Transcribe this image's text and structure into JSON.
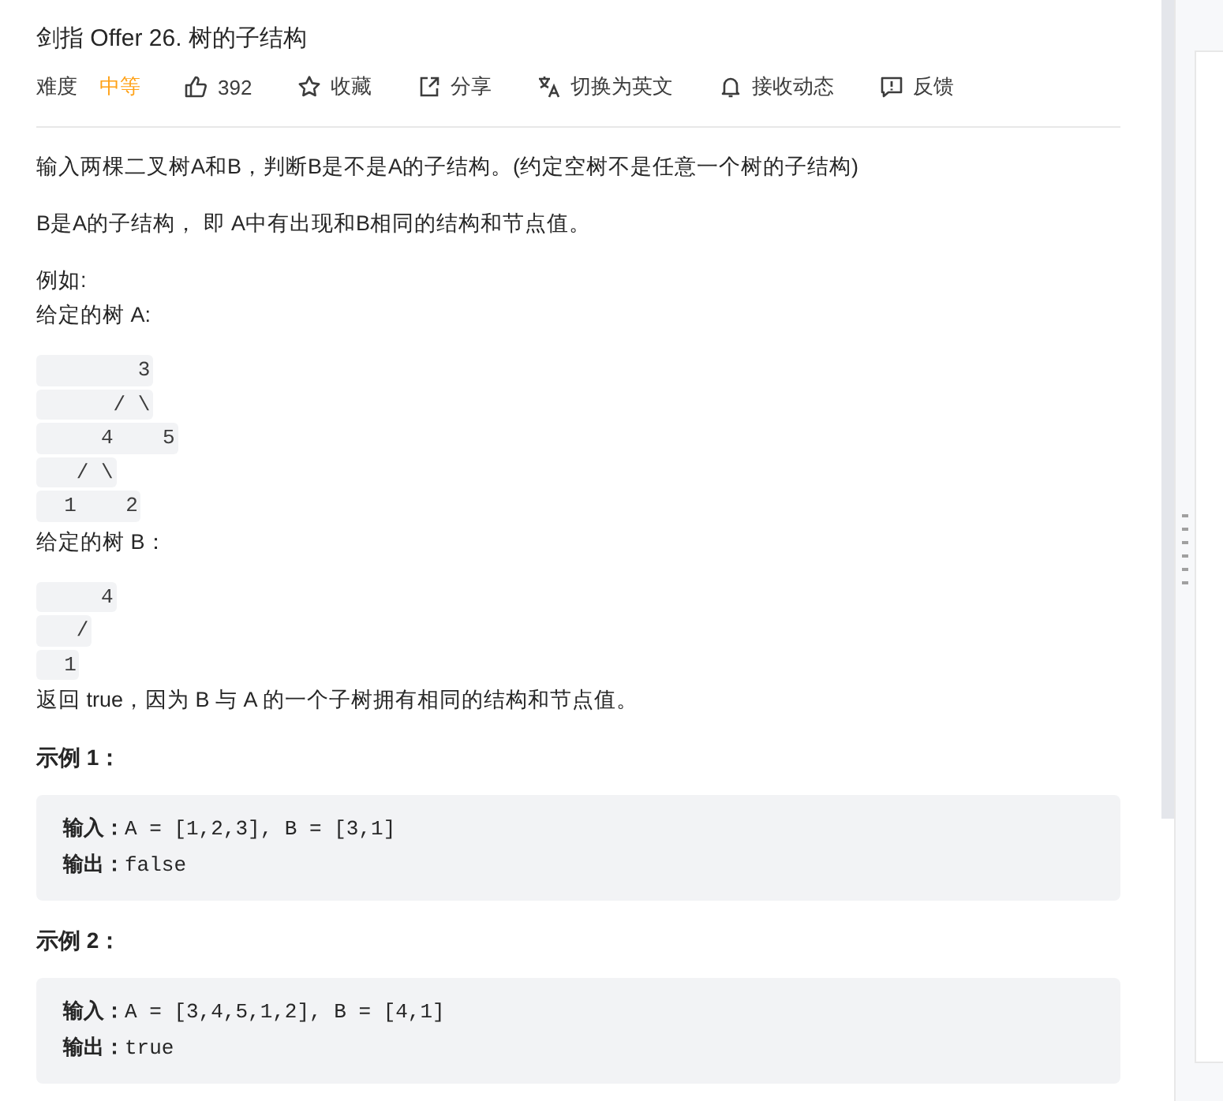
{
  "title": "剑指 Offer 26. 树的子结构",
  "toolbar": {
    "difficulty_label": "难度",
    "difficulty": "中等",
    "actions": [
      {
        "kind": "like",
        "label": "392"
      },
      {
        "kind": "favorite",
        "label": "收藏"
      },
      {
        "kind": "share",
        "label": "分享"
      },
      {
        "kind": "language",
        "label": "切换为英文"
      },
      {
        "kind": "subscribe",
        "label": "接收动态"
      },
      {
        "kind": "feedback",
        "label": "反馈"
      }
    ]
  },
  "description": [
    {
      "kind": "para",
      "text": "输入两棵二叉树A和B，判断B是不是A的子结构。(约定空树不是任意一个树的子结构)"
    },
    {
      "kind": "para",
      "text": "B是A的子结构， 即 A中有出现和B相同的结构和节点值。"
    },
    {
      "kind": "line",
      "text": "例如:"
    },
    {
      "kind": "line",
      "text": "给定的树 A:"
    },
    {
      "kind": "tree",
      "lines": [
        "        3",
        "      / \\",
        "     4    5",
        "   / \\",
        "  1    2"
      ]
    },
    {
      "kind": "line",
      "text": "给定的树 B："
    },
    {
      "kind": "tree",
      "lines": [
        "     4",
        "   /",
        "  1"
      ]
    },
    {
      "kind": "line",
      "text": "返回 true，因为 B 与 A 的一个子树拥有相同的结构和节点值。"
    }
  ],
  "examples": [
    {
      "heading": "示例 1：",
      "input": "**输入：**A = [1,2,3], B = [3,1]",
      "output": "**输出：**false"
    },
    {
      "heading": "示例 2：",
      "input": "**输入：**A = [3,4,5,1,2], B = [4,1]",
      "output": "**输出：**true"
    }
  ]
}
